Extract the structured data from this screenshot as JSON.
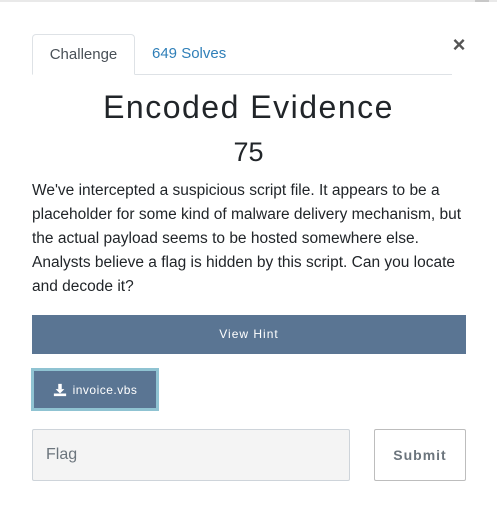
{
  "modal": {
    "close_symbol": "×",
    "close_icon": "close-icon"
  },
  "tabs": [
    {
      "label": "Challenge",
      "active": true
    },
    {
      "label": "649 Solves",
      "active": false
    }
  ],
  "challenge": {
    "name": "Encoded Evidence",
    "points": "75",
    "description": "We've intercepted a suspicious script file. It appears to be a placeholder for some kind of malware delivery mechanism, but the actual payload seems to be hosted somewhere else. Analysts believe a flag is hidden by this script. Can you locate and decode it?",
    "hint_label": "View Hint",
    "file": {
      "name": "invoice.vbs",
      "icon": "download-icon"
    }
  },
  "form": {
    "flag_placeholder": "Flag",
    "flag_value": "",
    "submit_label": "Submit"
  },
  "colors": {
    "button_bg": "#5a7593",
    "tab_link": "#2f7fb8",
    "focus_ring": "#8fc3d2"
  }
}
